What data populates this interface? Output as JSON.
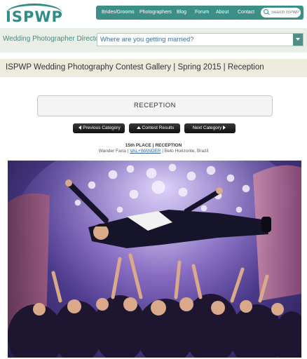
{
  "header": {
    "logo": "ISPWP",
    "nav": [
      {
        "label": "Brides/Grooms",
        "name": "nav-brides-grooms"
      },
      {
        "label": "Photographers",
        "name": "nav-photographers"
      },
      {
        "label": "Blog",
        "name": "nav-blog"
      },
      {
        "label": "Forum",
        "name": "nav-forum"
      },
      {
        "label": "About",
        "name": "nav-about"
      },
      {
        "label": "Contact",
        "name": "nav-contact"
      }
    ],
    "search_placeholder": "Search ISPWP"
  },
  "directory": {
    "label": "Wedding Photographer Directory",
    "placeholder": "Where are you getting married?"
  },
  "gallery": {
    "title": "ISPWP Wedding Photography Contest Gallery | Spring 2015 | Reception"
  },
  "category": {
    "name": "RECEPTION"
  },
  "buttons": {
    "previous": "Previous Category",
    "results": "Contest Results",
    "next": "Next Category"
  },
  "entry": {
    "place": "15th PLACE | RECEPTION",
    "photographer": "Wander Faria",
    "studio": "VAL+WANDER",
    "location": "Belo Horizonte, Brazil"
  },
  "colors": {
    "brand": "#3c8f87",
    "directory_bg": "#e9eee6",
    "gallery_bg": "#efeade",
    "button": "#1a1a1a"
  }
}
